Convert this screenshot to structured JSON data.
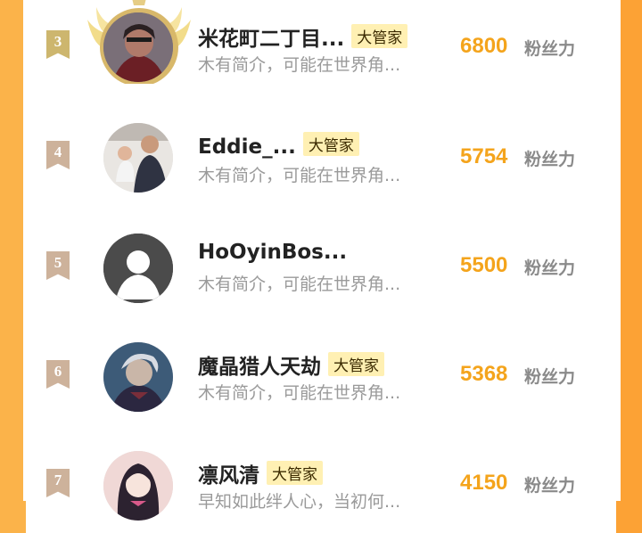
{
  "rows": [
    {
      "rank": "3",
      "name": "米花町二丁目...",
      "badge": "大管家",
      "bio": "木有简介，可能在世界角...",
      "score": "6800",
      "unit": "粉丝力",
      "rank_color": "#c9b36a"
    },
    {
      "rank": "4",
      "name": "Eddie_...",
      "badge": "大管家",
      "bio": "木有简介，可能在世界角...",
      "score": "5754",
      "unit": "粉丝力",
      "rank_color": "#c9ad95"
    },
    {
      "rank": "5",
      "name": "HoOyinBos...",
      "badge": "",
      "bio": "木有简介，可能在世界角...",
      "score": "5500",
      "unit": "粉丝力",
      "rank_color": "#c9ad95"
    },
    {
      "rank": "6",
      "name": "魔晶猎人天劫",
      "badge": "大管家",
      "bio": "木有简介，可能在世界角...",
      "score": "5368",
      "unit": "粉丝力",
      "rank_color": "#c9ad95"
    },
    {
      "rank": "7",
      "name": "凛风清",
      "badge": "大管家",
      "bio": "早知如此绊人心，当初何...",
      "score": "4150",
      "unit": "粉丝力",
      "rank_color": "#c9ad95"
    }
  ]
}
